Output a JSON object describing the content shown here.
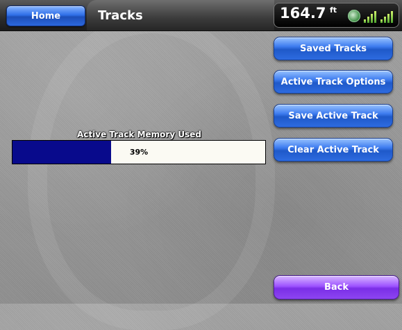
{
  "header": {
    "home_label": "Home",
    "title": "Tracks",
    "depth_value": "164.7",
    "depth_unit": "ft",
    "status_icons": [
      "gps-icon",
      "signal-bars-icon",
      "signal-bars-icon"
    ]
  },
  "memory": {
    "label": "Active Track Memory Used",
    "percent_text": "39%",
    "percent_value": 0.39
  },
  "menu": {
    "saved_tracks": "Saved Tracks",
    "active_track_options": "Active Track Options",
    "save_active_track": "Save Active Track",
    "clear_active_track": "Clear Active Track",
    "back": "Back"
  },
  "colors": {
    "accent_blue": "#2f6fe8",
    "back_purple": "#9d52ff",
    "memory_fill": "#080a8c"
  }
}
